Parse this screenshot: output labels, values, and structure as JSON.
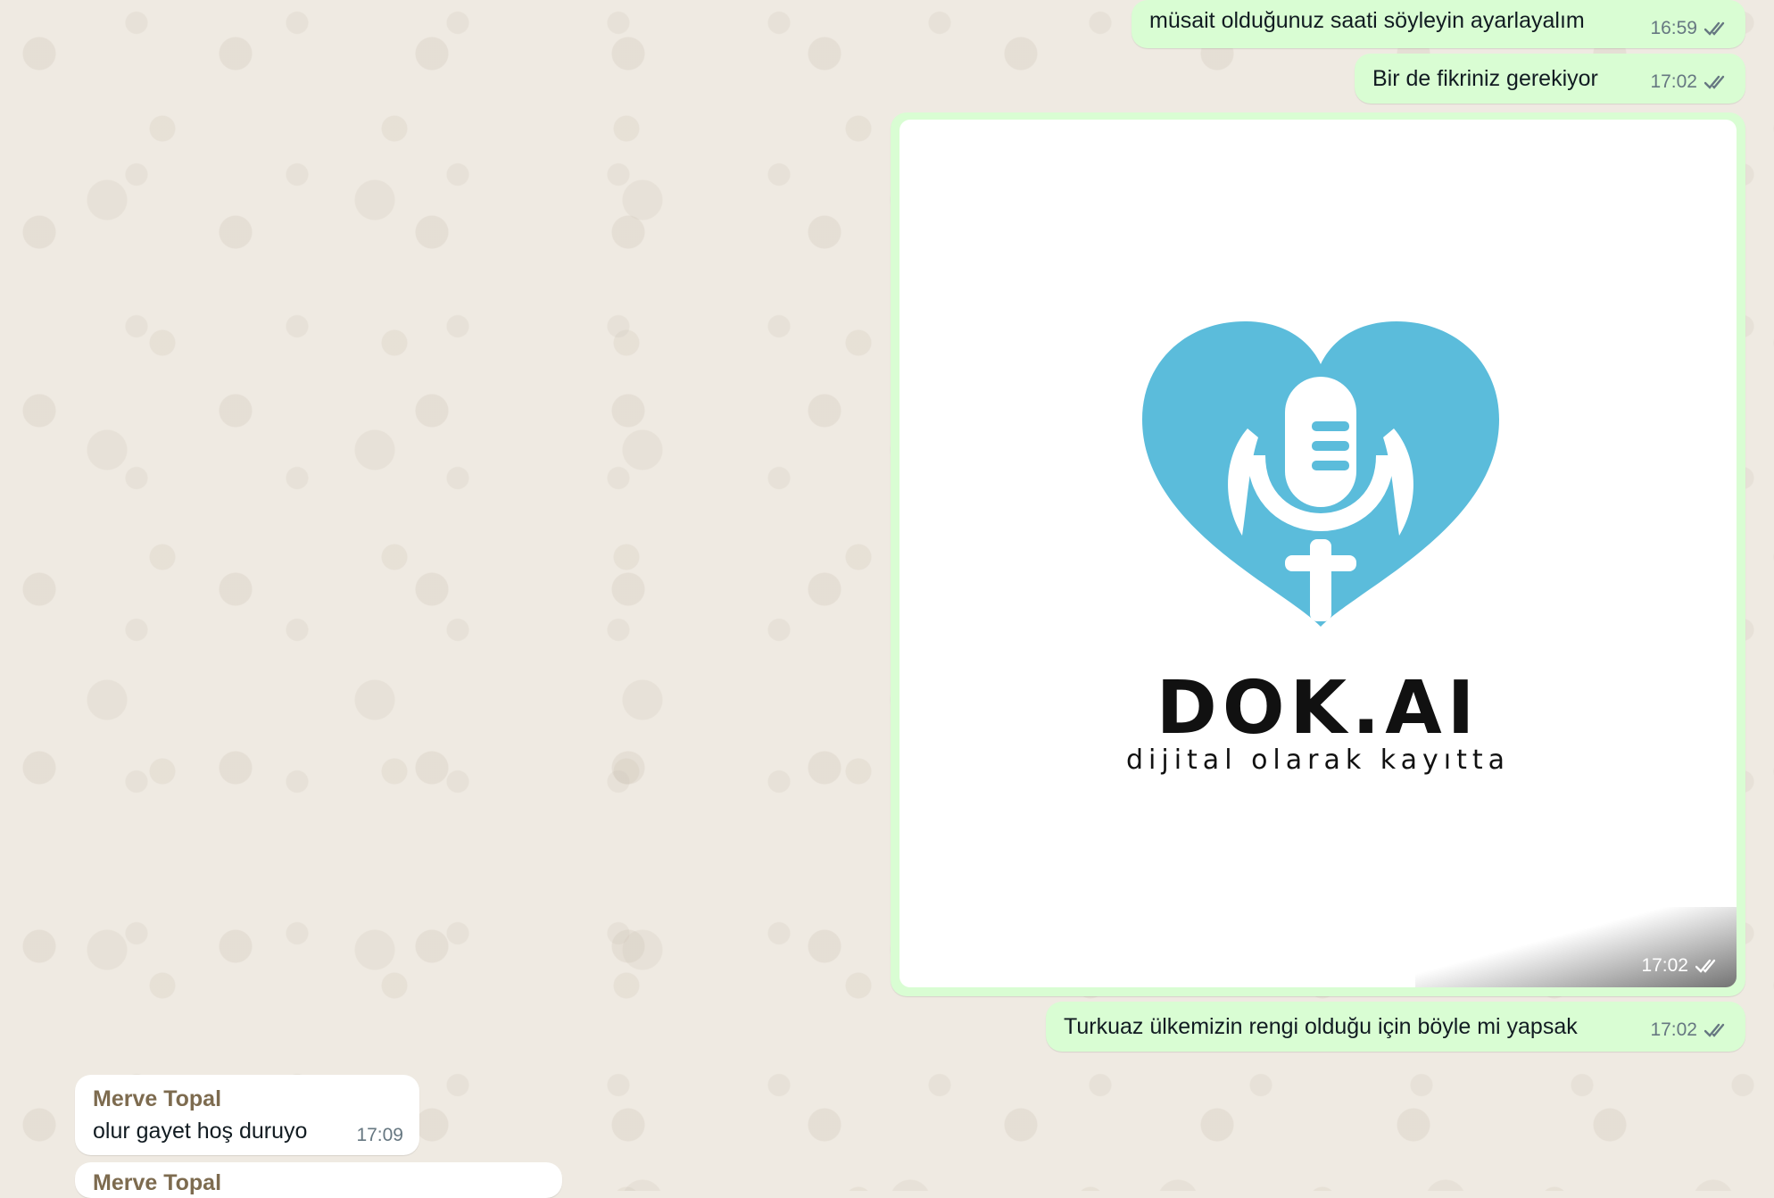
{
  "messages_out": [
    {
      "text": "müsait olduğunuz saati söyleyin ayarlayalım",
      "time": "16:59"
    },
    {
      "text": "Bir de fikriniz gerekiyor",
      "time": "17:02"
    }
  ],
  "image_message": {
    "logo_name": "DOK.AI",
    "logo_tagline": "dijital olarak kayıtta",
    "time": "17:02",
    "logo_color": "#5bbcdb"
  },
  "message_after_image": {
    "text": "Turkuaz ülkemizin rengi olduğu için böyle mi yapsak",
    "time": "17:02"
  },
  "incoming": [
    {
      "sender": "Merve Topal",
      "text": "olur gayet hoş duruyo",
      "time": "17:09"
    },
    {
      "sender": "Merve Topal"
    }
  ],
  "colors": {
    "outgoing_bubble": "#d9fdd3",
    "incoming_bubble": "#ffffff",
    "sender_name": "#7d6b4f",
    "read_ticks": "#667781"
  }
}
